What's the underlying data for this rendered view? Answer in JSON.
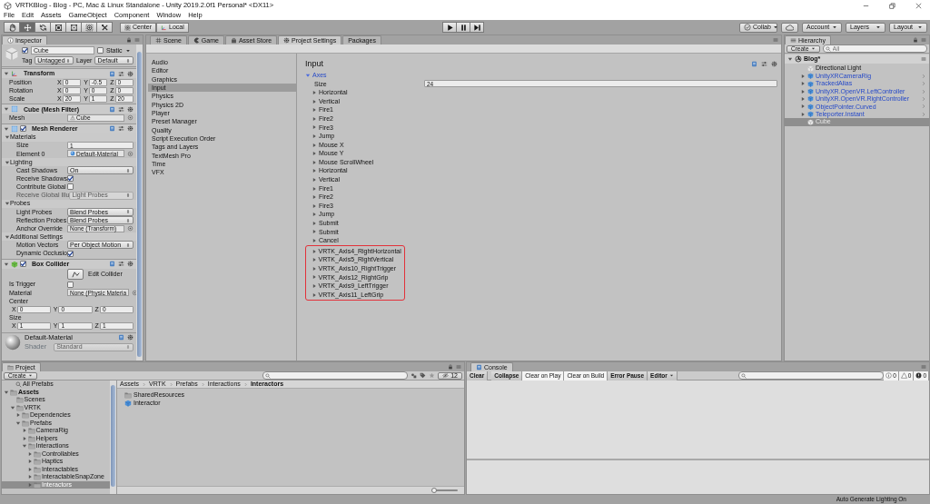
{
  "window": {
    "title": "VRTKBlog - Blog - PC, Mac & Linux Standalone - Unity 2019.2.0f1 Personal* <DX11>"
  },
  "menu": [
    "File",
    "Edit",
    "Assets",
    "GameObject",
    "Component",
    "Window",
    "Help"
  ],
  "toolbar": {
    "tools": [
      {
        "kind": "hand",
        "selected": false
      },
      {
        "kind": "move",
        "selected": true
      },
      {
        "kind": "rotate",
        "selected": false
      },
      {
        "kind": "scale",
        "selected": false
      },
      {
        "kind": "rect",
        "selected": false
      },
      {
        "kind": "transform",
        "selected": false
      },
      {
        "kind": "custom",
        "selected": false
      }
    ],
    "pivot": [
      {
        "label": "Center",
        "kind": "center"
      },
      {
        "label": "Local",
        "kind": "local"
      }
    ],
    "playback": [
      {
        "kind": "play",
        "selected": false
      },
      {
        "kind": "pause",
        "selected": false
      },
      {
        "kind": "step",
        "selected": false
      }
    ],
    "collab": "Collab",
    "account": "Account",
    "layers": "Layers",
    "layout": "Layout"
  },
  "inspector": {
    "tab": "Inspector",
    "object": {
      "name": "Cube",
      "active": true,
      "static_label": "Static",
      "static": false,
      "tag_label": "Tag",
      "tag": "Untagged",
      "layer_label": "Layer",
      "layer": "Default"
    },
    "components": [
      {
        "title": "Transform",
        "kind": "transform",
        "rows": [
          {
            "kind": "vector",
            "label": "Position",
            "values": [
              {
                "axis": "X",
                "value": "0"
              },
              {
                "axis": "Y",
                "value": "-0.5"
              },
              {
                "axis": "Z",
                "value": "0"
              }
            ]
          },
          {
            "kind": "vector",
            "label": "Rotation",
            "values": [
              {
                "axis": "X",
                "value": "0"
              },
              {
                "axis": "Y",
                "value": "0"
              },
              {
                "axis": "Z",
                "value": "0"
              }
            ]
          },
          {
            "kind": "vector",
            "label": "Scale",
            "values": [
              {
                "axis": "X",
                "value": "20"
              },
              {
                "axis": "Y",
                "value": "1"
              },
              {
                "axis": "Z",
                "value": "20"
              }
            ]
          }
        ]
      },
      {
        "title": "Cube (Mesh Filter)",
        "kind": "mesh_filter",
        "rows": [
          {
            "kind": "mesh",
            "label": "Mesh",
            "value": "Cube"
          }
        ]
      },
      {
        "title": "Mesh Renderer",
        "kind": "mesh_renderer",
        "enabled": true,
        "rows": [
          {
            "kind": "section",
            "label": "Materials",
            "expanded": true
          },
          {
            "kind": "number",
            "label": "Size",
            "value": "1"
          },
          {
            "kind": "material",
            "label": "Element 0",
            "value": "Default-Material"
          },
          {
            "kind": "section",
            "label": "Lighting",
            "expanded": true
          },
          {
            "kind": "dropdown",
            "label": "Cast Shadows",
            "value": "On"
          },
          {
            "kind": "check",
            "label": "Receive Shadows",
            "checked": true
          },
          {
            "kind": "check",
            "label": "Contribute Global",
            "checked": false
          },
          {
            "kind": "dropdown",
            "label": "Receive Global Illu",
            "value": "Light Probes",
            "disabled": true
          },
          {
            "kind": "section",
            "label": "Probes",
            "expanded": true
          },
          {
            "kind": "dropdown",
            "label": "Light Probes",
            "value": "Blend Probes"
          },
          {
            "kind": "dropdown",
            "label": "Reflection Probes",
            "value": "Blend Probes"
          },
          {
            "kind": "object",
            "label": "Anchor Override",
            "value": "None (Transform)"
          },
          {
            "kind": "section",
            "label": "Additional Settings",
            "expanded": true
          },
          {
            "kind": "dropdown",
            "label": "Motion Vectors",
            "value": "Per Object Motion"
          },
          {
            "kind": "check",
            "label": "Dynamic Occlusio",
            "checked": true
          }
        ]
      },
      {
        "title": "Box Collider",
        "kind": "box_collider",
        "enabled": true,
        "rows": [
          {
            "kind": "button",
            "label": "Edit Collider"
          },
          {
            "kind": "check",
            "label": "Is Trigger",
            "checked": false
          },
          {
            "kind": "object",
            "label": "Material",
            "value": "None (Physic Materia"
          },
          {
            "kind": "label",
            "label": "Center"
          },
          {
            "kind": "vector",
            "values": [
              {
                "axis": "X",
                "value": "0"
              },
              {
                "axis": "Y",
                "value": "0"
              },
              {
                "axis": "Z",
                "value": "0"
              }
            ]
          },
          {
            "kind": "label",
            "label": "Size"
          },
          {
            "kind": "vector",
            "values": [
              {
                "axis": "X",
                "value": "1"
              },
              {
                "axis": "Y",
                "value": "1"
              },
              {
                "axis": "Z",
                "value": "1"
              }
            ]
          }
        ]
      }
    ],
    "material_preview": {
      "name": "Default-Material",
      "shader_label": "Shader",
      "shader": "Standard"
    }
  },
  "center_tabs": [
    {
      "label": "Scene",
      "kind": "scene",
      "selected": false
    },
    {
      "label": "Game",
      "kind": "game",
      "selected": false
    },
    {
      "label": "Asset Store",
      "kind": "store",
      "selected": false
    },
    {
      "label": "Project Settings",
      "kind": "settings",
      "selected": true
    },
    {
      "label": "Packages",
      "kind": "packages",
      "selected": false
    }
  ],
  "project_settings": {
    "categories": [
      {
        "label": "Audio",
        "selected": false
      },
      {
        "label": "Editor",
        "selected": false
      },
      {
        "label": "Graphics",
        "selected": false
      },
      {
        "label": "Input",
        "selected": true
      },
      {
        "label": "Physics",
        "selected": false
      },
      {
        "label": "Physics 2D",
        "selected": false
      },
      {
        "label": "Player",
        "selected": false
      },
      {
        "label": "Preset Manager",
        "selected": false
      },
      {
        "label": "Quality",
        "selected": false
      },
      {
        "label": "Script Execution Order",
        "selected": false
      },
      {
        "label": "Tags and Layers",
        "selected": false
      },
      {
        "label": "TextMesh Pro",
        "selected": false
      },
      {
        "label": "Time",
        "selected": false
      },
      {
        "label": "VFX",
        "selected": false
      }
    ],
    "title": "Input",
    "axes": {
      "label": "Axes",
      "expanded": true,
      "size_label": "Size",
      "size": "24",
      "items": [
        {
          "label": "Horizontal",
          "highlighted": false
        },
        {
          "label": "Vertical",
          "highlighted": false
        },
        {
          "label": "Fire1",
          "highlighted": false
        },
        {
          "label": "Fire2",
          "highlighted": false
        },
        {
          "label": "Fire3",
          "highlighted": false
        },
        {
          "label": "Jump",
          "highlighted": false
        },
        {
          "label": "Mouse X",
          "highlighted": false
        },
        {
          "label": "Mouse Y",
          "highlighted": false
        },
        {
          "label": "Mouse ScrollWheel",
          "highlighted": false
        },
        {
          "label": "Horizontal",
          "highlighted": false
        },
        {
          "label": "Vertical",
          "highlighted": false
        },
        {
          "label": "Fire1",
          "highlighted": false
        },
        {
          "label": "Fire2",
          "highlighted": false
        },
        {
          "label": "Fire3",
          "highlighted": false
        },
        {
          "label": "Jump",
          "highlighted": false
        },
        {
          "label": "Submit",
          "highlighted": false
        },
        {
          "label": "Submit",
          "highlighted": false
        },
        {
          "label": "Cancel",
          "highlighted": false
        },
        {
          "label": "VRTK_Axis4_RightHorizontal",
          "highlighted": true
        },
        {
          "label": "VRTK_Axis5_RightVertical",
          "highlighted": true
        },
        {
          "label": "VRTK_Axis10_RightTrigger",
          "highlighted": true
        },
        {
          "label": "VRTK_Axis12_RightGrip",
          "highlighted": true
        },
        {
          "label": "VRTK_Axis9_LeftTrigger",
          "highlighted": true
        },
        {
          "label": "VRTK_Axis11_LeftGrip",
          "highlighted": true
        }
      ]
    }
  },
  "hierarchy": {
    "tab": "Hierarchy",
    "create": "Create",
    "search_placeholder": "All",
    "scene": {
      "label": "Blog*",
      "expanded": true,
      "children": [
        {
          "label": "Directional Light",
          "kind": "object",
          "selected": false
        },
        {
          "label": "UnityXRCameraRig",
          "kind": "prefab",
          "expanded": false,
          "selected": false
        },
        {
          "label": "TrackedAlias",
          "kind": "prefab",
          "expanded": false,
          "selected": false
        },
        {
          "label": "UnityXR.OpenVR.LeftController",
          "kind": "prefab",
          "expanded": false,
          "selected": false
        },
        {
          "label": "UnityXR.OpenVR.RightController",
          "kind": "prefab",
          "expanded": false,
          "selected": false
        },
        {
          "label": "ObjectPointer.Curved",
          "kind": "prefab",
          "expanded": false,
          "selected": false
        },
        {
          "label": "Teleporter.Instant",
          "kind": "prefab",
          "expanded": false,
          "selected": false
        },
        {
          "label": "Cube",
          "kind": "object",
          "selected": true
        }
      ]
    }
  },
  "project": {
    "tab": "Project",
    "create": "Create",
    "hidden_count": "12",
    "favorites": [
      {
        "label": "All Prefabs"
      }
    ],
    "tree": [
      {
        "label": "Assets",
        "expanded": true,
        "selected": false,
        "children": [
          {
            "label": "Scenes",
            "selected": false
          },
          {
            "label": "VRTK",
            "expanded": true,
            "selected": false,
            "children": [
              {
                "label": "Dependencies",
                "expanded": false,
                "selected": false
              },
              {
                "label": "Prefabs",
                "expanded": true,
                "selected": false,
                "children": [
                  {
                    "label": "CameraRig",
                    "expanded": false,
                    "selected": false
                  },
                  {
                    "label": "Helpers",
                    "expanded": false,
                    "selected": false
                  },
                  {
                    "label": "Interactions",
                    "expanded": true,
                    "selected": false,
                    "children": [
                      {
                        "label": "Controllables",
                        "expanded": false,
                        "selected": false
                      },
                      {
                        "label": "Haptics",
                        "expanded": false,
                        "selected": false
                      },
                      {
                        "label": "Interactables",
                        "expanded": false,
                        "selected": false
                      },
                      {
                        "label": "InteractableSnapZone",
                        "expanded": false,
                        "selected": false
                      },
                      {
                        "label": "Interactors",
                        "expanded": false,
                        "selected": true
                      }
                    ]
                  }
                ]
              }
            ]
          }
        ]
      }
    ],
    "breadcrumb": [
      "Assets",
      "VRTK",
      "Prefabs",
      "Interactions",
      "Interactors"
    ],
    "items": [
      {
        "label": "SharedResources",
        "kind": "folder"
      },
      {
        "label": "Interactor",
        "kind": "prefab"
      }
    ],
    "icon_size": {
      "level": 0
    }
  },
  "console": {
    "tab": "Console",
    "buttons": [
      {
        "label": "Clear",
        "kind": "button"
      },
      {
        "label": "Collapse",
        "kind": "toggle",
        "on": false
      },
      {
        "label": "Clear on Play",
        "kind": "toggle",
        "on": true
      },
      {
        "label": "Clear on Build",
        "kind": "toggle",
        "on": true
      },
      {
        "label": "Error Pause",
        "kind": "toggle",
        "on": false
      },
      {
        "label": "Editor",
        "kind": "dropdown"
      }
    ],
    "counts": [
      {
        "kind": "info",
        "count": "0"
      },
      {
        "kind": "warning",
        "count": "0"
      },
      {
        "kind": "error",
        "count": "0"
      }
    ]
  },
  "status_bar": {
    "text": "Auto Generate Lighting On"
  }
}
